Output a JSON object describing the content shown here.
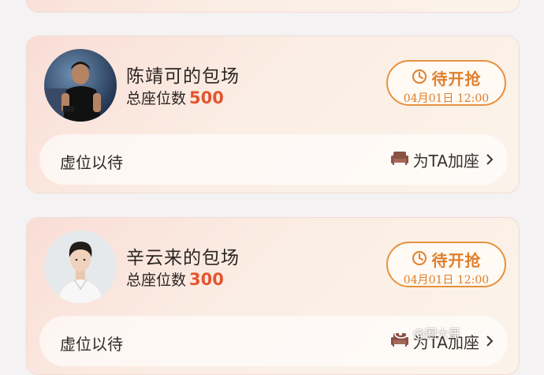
{
  "cards": [
    {
      "name": "陈靖可的包场",
      "seats_label": "总座位数",
      "seats_value": "500",
      "status": {
        "label": "待开抢",
        "time": "04月01日 12:00"
      },
      "vacancy_text": "虚位以待",
      "add_seat_label": "为TA加座"
    },
    {
      "name": "辛云来的包场",
      "seats_label": "总座位数",
      "seats_value": "300",
      "status": {
        "label": "待开抢",
        "time": "04月01日 12:00"
      },
      "vacancy_text": "虚位以待",
      "add_seat_label": "为TA加座"
    }
  ],
  "watermark": "@圈大哥",
  "colors": {
    "accent_orange": "#e8913f",
    "seat_number_red": "#e2552f",
    "card_gradient_start": "#f9ddd6",
    "card_gradient_end": "#fbf3ea"
  },
  "icons": {
    "status": "clock-icon",
    "add_seat": "sofa-icon",
    "chevron": "chevron-right-icon",
    "watermark": "weibo-icon"
  }
}
